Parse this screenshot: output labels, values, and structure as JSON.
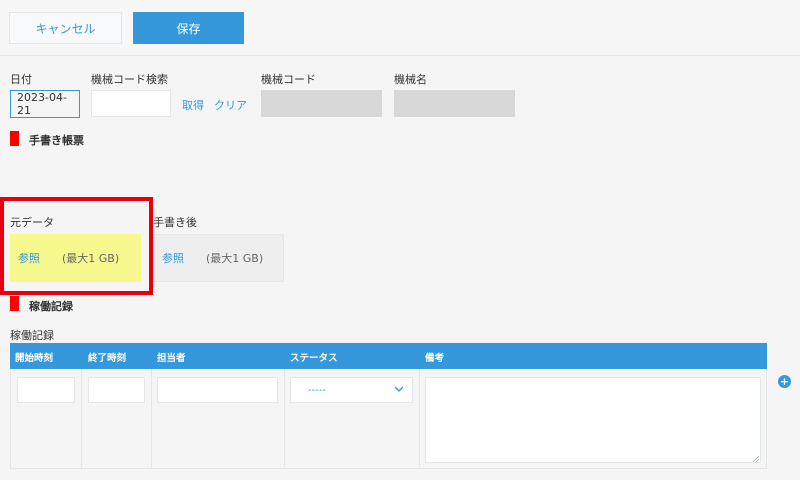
{
  "toolbar": {
    "cancel_label": "キャンセル",
    "save_label": "保存"
  },
  "fields": {
    "date": {
      "label": "日付",
      "value": "2023-04-21"
    },
    "machine_code_search": {
      "label": "機械コード検索",
      "value": "",
      "fetch_link": "取得",
      "clear_link": "クリア"
    },
    "machine_code": {
      "label": "機械コード",
      "value": ""
    },
    "machine_name": {
      "label": "機械名",
      "value": ""
    }
  },
  "handwritten_section": {
    "title": "手書き帳票",
    "original": {
      "label": "元データ",
      "browse": "参照",
      "limit": "(最大1 GB)"
    },
    "after": {
      "label": "手書き後",
      "browse": "参照",
      "limit": "(最大1 GB)"
    }
  },
  "operation_section": {
    "title": "稼働記録",
    "table_label": "稼働記録",
    "columns": [
      "開始時刻",
      "終了時刻",
      "担当者",
      "ステータス",
      "備考"
    ],
    "row": {
      "start": "",
      "end": "",
      "person": "",
      "status": "-----",
      "notes": ""
    }
  },
  "colors": {
    "accent": "#3498db",
    "highlight_fill": "#f7f98f",
    "highlight_frame": "#e60012",
    "section_marker": "#ff0000"
  },
  "icons": [
    "chevron-down-icon",
    "resize-handle-icon",
    "plus-icon"
  ]
}
